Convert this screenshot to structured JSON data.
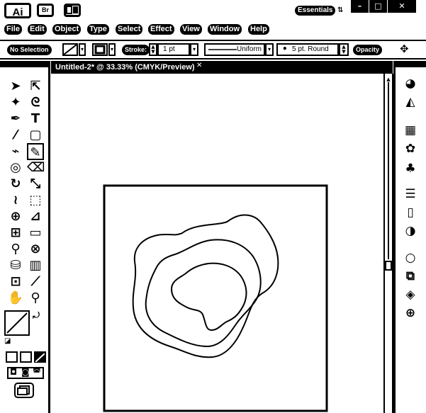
{
  "app": {
    "logo_text": "Ai",
    "bridge_label": "Br"
  },
  "workspace": {
    "label": "Essentials"
  },
  "window_controls": {
    "minimize": "–",
    "maximize": "□",
    "close": "✕"
  },
  "menu": [
    "File",
    "Edit",
    "Object",
    "Type",
    "Select",
    "Effect",
    "View",
    "Window",
    "Help"
  ],
  "control_bar": {
    "selection_status": "No Selection",
    "stroke_label": "Stroke:",
    "stroke_weight": "1 pt",
    "stroke_profile": "Uniform",
    "brush": "5 pt. Round",
    "opacity_label": "Opacity"
  },
  "document": {
    "tab_title": "Untitled-2* @ 33.33% (CMYK/Preview)",
    "close_glyph": "✕"
  },
  "tools": [
    {
      "name": "selection-tool",
      "icon": "arrow-icon",
      "glyph": "➤"
    },
    {
      "name": "direct-selection-tool",
      "icon": "white-arrow-icon",
      "glyph": "⇱"
    },
    {
      "name": "magic-wand-tool",
      "icon": "wand-icon",
      "glyph": "✦"
    },
    {
      "name": "lasso-tool",
      "icon": "lasso-icon",
      "glyph": "ᘓ"
    },
    {
      "name": "pen-tool",
      "icon": "pen-icon",
      "glyph": "✒"
    },
    {
      "name": "type-tool",
      "icon": "type-icon",
      "glyph": "T"
    },
    {
      "name": "line-segment-tool",
      "icon": "line-icon",
      "glyph": "⁄"
    },
    {
      "name": "rectangle-tool",
      "icon": "rectangle-icon",
      "glyph": "▢"
    },
    {
      "name": "paintbrush-tool",
      "icon": "brush-icon",
      "glyph": "⌁"
    },
    {
      "name": "pencil-tool",
      "icon": "pencil-icon",
      "glyph": "✎"
    },
    {
      "name": "blob-brush-tool",
      "icon": "blob-icon",
      "glyph": "◎"
    },
    {
      "name": "eraser-tool",
      "icon": "eraser-icon",
      "glyph": "⌫"
    },
    {
      "name": "rotate-tool",
      "icon": "rotate-icon",
      "glyph": "↻"
    },
    {
      "name": "scale-tool",
      "icon": "scale-icon",
      "glyph": "⤡"
    },
    {
      "name": "warp-tool",
      "icon": "warp-icon",
      "glyph": "≀"
    },
    {
      "name": "free-transform-tool",
      "icon": "transform-icon",
      "glyph": "⬚"
    },
    {
      "name": "shape-builder-tool",
      "icon": "shape-builder-icon",
      "glyph": "⊕"
    },
    {
      "name": "perspective-grid-tool",
      "icon": "perspective-icon",
      "glyph": "⊿"
    },
    {
      "name": "mesh-tool",
      "icon": "mesh-icon",
      "glyph": "⊞"
    },
    {
      "name": "gradient-tool",
      "icon": "gradient-icon",
      "glyph": "▭"
    },
    {
      "name": "eyedropper-tool",
      "icon": "eyedropper-icon",
      "glyph": "⚲"
    },
    {
      "name": "blend-tool",
      "icon": "blend-icon",
      "glyph": "⊗"
    },
    {
      "name": "symbol-sprayer-tool",
      "icon": "sprayer-icon",
      "glyph": "⛁"
    },
    {
      "name": "column-graph-tool",
      "icon": "graph-icon",
      "glyph": "▥"
    },
    {
      "name": "artboard-tool",
      "icon": "artboard-icon",
      "glyph": "⊡"
    },
    {
      "name": "slice-tool",
      "icon": "slice-icon",
      "glyph": "⟋"
    },
    {
      "name": "hand-tool",
      "icon": "hand-icon",
      "glyph": "✋"
    },
    {
      "name": "zoom-tool",
      "icon": "zoom-icon",
      "glyph": "⚲"
    }
  ],
  "right_panel": [
    {
      "name": "color-panel-button",
      "icon": "palette-icon",
      "glyph": "◕"
    },
    {
      "name": "color-guide-button",
      "icon": "color-guide-icon",
      "glyph": "◭"
    },
    {
      "name": "swatches-button",
      "icon": "swatches-icon",
      "glyph": "▦"
    },
    {
      "name": "brushes-button",
      "icon": "brushes-icon",
      "glyph": "✿"
    },
    {
      "name": "symbols-button",
      "icon": "symbols-icon",
      "glyph": "♣"
    },
    {
      "name": "stroke-panel-button",
      "icon": "stroke-icon",
      "glyph": "☰"
    },
    {
      "name": "gradient-panel-button",
      "icon": "gradient-panel-icon",
      "glyph": "▯"
    },
    {
      "name": "transparency-button",
      "icon": "transparency-icon",
      "glyph": "◑"
    },
    {
      "name": "appearance-button",
      "icon": "appearance-icon",
      "glyph": "○"
    },
    {
      "name": "graphic-styles-button",
      "icon": "graphic-styles-icon",
      "glyph": "⧉"
    },
    {
      "name": "layers-button",
      "icon": "layers-icon",
      "glyph": "◈"
    },
    {
      "name": "artboards-button",
      "icon": "artboards-icon",
      "glyph": "⊕"
    }
  ]
}
